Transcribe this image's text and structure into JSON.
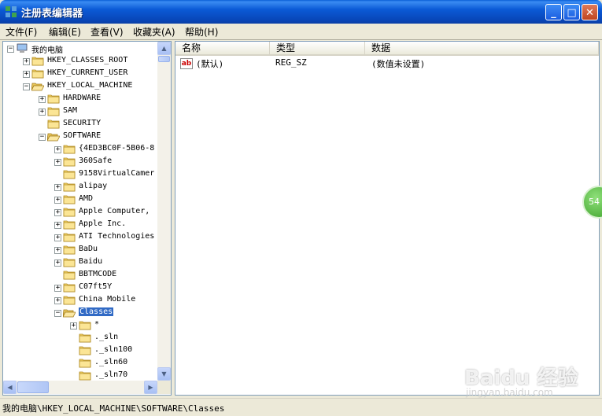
{
  "window": {
    "title": "注册表编辑器"
  },
  "menu": [
    "文件(F)",
    "编辑(E)",
    "查看(V)",
    "收藏夹(A)",
    "帮助(H)"
  ],
  "tree": [
    {
      "label": "我的电脑",
      "expander": "minus"
    },
    {
      "label": "HKEY_CLASSES_ROOT",
      "expander": "plus"
    },
    {
      "label": "HKEY_CURRENT_USER",
      "expander": "plus"
    },
    {
      "label": "HKEY_LOCAL_MACHINE",
      "expander": "minus"
    },
    {
      "label": "HARDWARE",
      "expander": "plus"
    },
    {
      "label": "SAM",
      "expander": "plus"
    },
    {
      "label": "SECURITY",
      "expander": "none"
    },
    {
      "label": "SOFTWARE",
      "expander": "minus"
    },
    {
      "label": "{4ED3BC0F-5B06-8",
      "expander": "plus"
    },
    {
      "label": "360Safe",
      "expander": "plus"
    },
    {
      "label": "9158VirtualCamer",
      "expander": "none"
    },
    {
      "label": "alipay",
      "expander": "plus"
    },
    {
      "label": "AMD",
      "expander": "plus"
    },
    {
      "label": "Apple Computer,",
      "expander": "plus"
    },
    {
      "label": "Apple Inc.",
      "expander": "plus"
    },
    {
      "label": "ATI Technologies",
      "expander": "plus"
    },
    {
      "label": "BaDu",
      "expander": "plus"
    },
    {
      "label": "Baidu",
      "expander": "plus"
    },
    {
      "label": "BBTMCODE",
      "expander": "none"
    },
    {
      "label": "C07ft5Y",
      "expander": "plus"
    },
    {
      "label": "China Mobile",
      "expander": "plus"
    },
    {
      "label": "Classes",
      "expander": "minus",
      "selected": true
    },
    {
      "label": "*",
      "expander": "plus"
    },
    {
      "label": "._sln",
      "expander": "none"
    },
    {
      "label": "._sln100",
      "expander": "none"
    },
    {
      "label": "._sln60",
      "expander": "none"
    },
    {
      "label": "._sln70",
      "expander": "none"
    }
  ],
  "list": {
    "columns": [
      "名称",
      "类型",
      "数据"
    ],
    "rows": [
      {
        "icon": "ab",
        "name": "(默认)",
        "type": "REG_SZ",
        "data": "(数值未设置)"
      }
    ]
  },
  "status": "我的电脑\\HKEY_LOCAL_MACHINE\\SOFTWARE\\Classes",
  "badge": "54",
  "watermark": {
    "brand": "Baidu 经验",
    "url": "jingyan.baidu.com"
  }
}
